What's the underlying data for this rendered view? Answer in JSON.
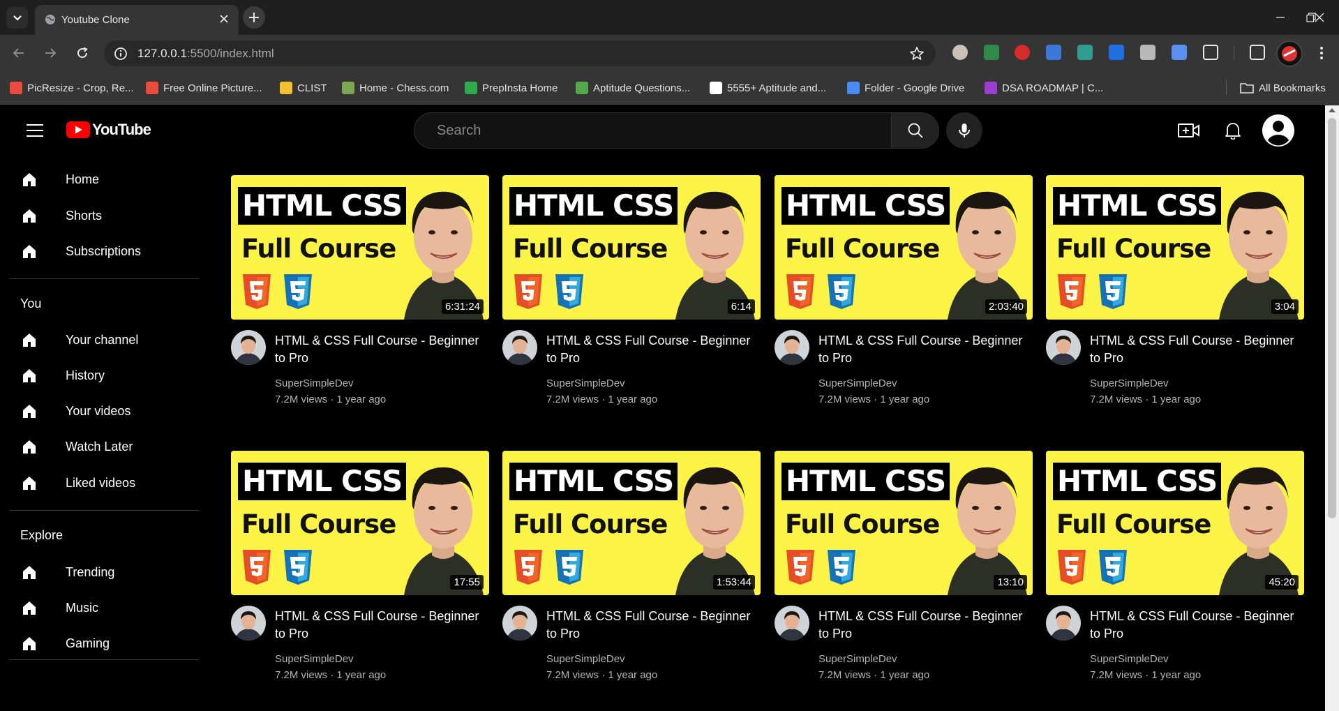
{
  "browser": {
    "tab_title": "Youtube Clone",
    "url_host": "127.0.0.1",
    "url_rest": ":5500/index.html",
    "bookmarks": [
      {
        "label": "PicResize - Crop, Re...",
        "color": "#e94b3c"
      },
      {
        "label": "Free Online Picture...",
        "color": "#e94b3c"
      },
      {
        "label": "CLIST",
        "color": "#f2c12e"
      },
      {
        "label": "Home - Chess.com",
        "color": "#7fa650"
      },
      {
        "label": "PrepInsta Home",
        "color": "#2eaa4f"
      },
      {
        "label": "Aptitude Questions...",
        "color": "#55a84a"
      },
      {
        "label": "5555+ Aptitude and...",
        "color": "#ffffff"
      },
      {
        "label": "Folder - Google Drive",
        "color": "#4a8af4"
      },
      {
        "label": "DSA ROADMAP | C...",
        "color": "#9b3fd1"
      }
    ],
    "all_bookmarks": "All Bookmarks"
  },
  "header": {
    "logo_text": "YouTube",
    "search_placeholder": "Search",
    "brand_red": "#ff0000"
  },
  "sidebar": {
    "main": [
      {
        "label": "Home"
      },
      {
        "label": "Shorts"
      },
      {
        "label": "Subscriptions"
      }
    ],
    "you_heading": "You",
    "you": [
      {
        "label": "Your channel"
      },
      {
        "label": "History"
      },
      {
        "label": "Your videos"
      },
      {
        "label": "Watch Later"
      },
      {
        "label": "Liked videos"
      }
    ],
    "explore_heading": "Explore",
    "explore": [
      {
        "label": "Trending"
      },
      {
        "label": "Music"
      },
      {
        "label": "Gaming"
      }
    ]
  },
  "videos": [
    {
      "thumb_line1": "HTML CSS",
      "thumb_line2": "Full Course",
      "duration": "6:31:24",
      "title": "HTML & CSS Full Course - Beginner to Pro",
      "channel": "SuperSimpleDev",
      "stats": "7.2M views · 1 year ago"
    },
    {
      "thumb_line1": "HTML CSS",
      "thumb_line2": "Full Course",
      "duration": "6:14",
      "title": "HTML & CSS Full Course - Beginner to Pro",
      "channel": "SuperSimpleDev",
      "stats": "7.2M views · 1 year ago"
    },
    {
      "thumb_line1": "HTML CSS",
      "thumb_line2": "Full Course",
      "duration": "2:03:40",
      "title": "HTML & CSS Full Course - Beginner to Pro",
      "channel": "SuperSimpleDev",
      "stats": "7.2M views · 1 year ago"
    },
    {
      "thumb_line1": "HTML CSS",
      "thumb_line2": "Full Course",
      "duration": "3:04",
      "title": "HTML & CSS Full Course - Beginner to Pro",
      "channel": "SuperSimpleDev",
      "stats": "7.2M views · 1 year ago"
    },
    {
      "thumb_line1": "HTML CSS",
      "thumb_line2": "Full Course",
      "duration": "17:55",
      "title": "HTML & CSS Full Course - Beginner to Pro",
      "channel": "SuperSimpleDev",
      "stats": "7.2M views · 1 year ago"
    },
    {
      "thumb_line1": "HTML CSS",
      "thumb_line2": "Full Course",
      "duration": "1:53:44",
      "title": "HTML & CSS Full Course - Beginner to Pro",
      "channel": "SuperSimpleDev",
      "stats": "7.2M views · 1 year ago"
    },
    {
      "thumb_line1": "HTML CSS",
      "thumb_line2": "Full Course",
      "duration": "13:10",
      "title": "HTML & CSS Full Course - Beginner to Pro",
      "channel": "SuperSimpleDev",
      "stats": "7.2M views · 1 year ago"
    },
    {
      "thumb_line1": "HTML CSS",
      "thumb_line2": "Full Course",
      "duration": "45:20",
      "title": "HTML & CSS Full Course - Beginner to Pro",
      "channel": "SuperSimpleDev",
      "stats": "7.2M views · 1 year ago"
    }
  ]
}
